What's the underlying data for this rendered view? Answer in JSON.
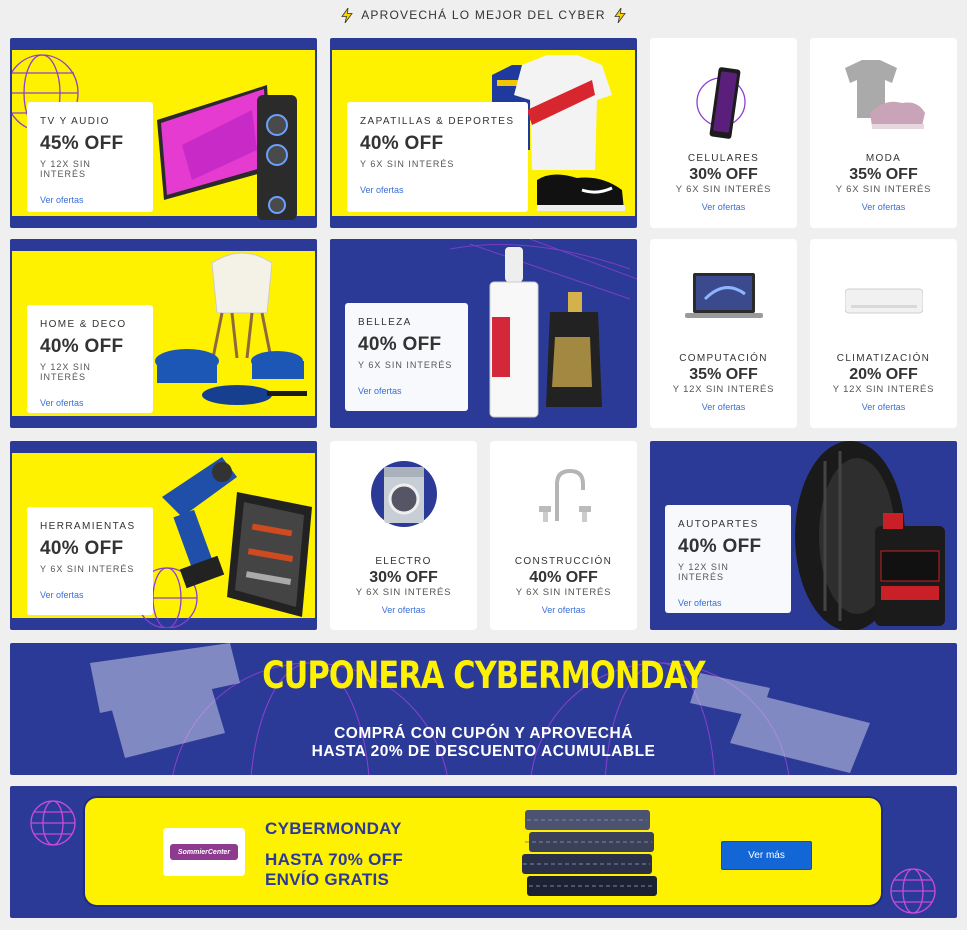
{
  "heading": {
    "text": "APROVECHÁ LO MEJOR DEL CYBER"
  },
  "colors": {
    "brand_blue": "#2c3a97",
    "brand_yellow": "#fff200",
    "link": "#3a6fd8",
    "button": "#1366d6"
  },
  "cards": [
    {
      "category": "TV Y AUDIO",
      "discount": "45% OFF",
      "installments": "Y 12X SIN INTERÉS",
      "link": "Ver ofertas"
    },
    {
      "category": "ZAPATILLAS & DEPORTES",
      "discount": "40% OFF",
      "installments": "Y 6X SIN INTERÉS",
      "link": "Ver ofertas"
    },
    {
      "category": "CELULARES",
      "discount": "30% OFF",
      "installments": "Y 6X SIN INTERÉS",
      "link": "Ver ofertas"
    },
    {
      "category": "MODA",
      "discount": "35% OFF",
      "installments": "Y 6X SIN INTERÉS",
      "link": "Ver ofertas"
    },
    {
      "category": "HOME & DECO",
      "discount": "40% OFF",
      "installments": "Y 12X SIN INTERÉS",
      "link": "Ver ofertas"
    },
    {
      "category": "BELLEZA",
      "discount": "40% OFF",
      "installments": "Y 6X SIN INTERÉS",
      "link": "Ver ofertas"
    },
    {
      "category": "COMPUTACIÓN",
      "discount": "35% OFF",
      "installments": "Y 12X SIN INTERÉS",
      "link": "Ver ofertas"
    },
    {
      "category": "CLIMATIZACIÓN",
      "discount": "20% OFF",
      "installments": "Y 12X SIN INTERÉS",
      "link": "Ver ofertas"
    },
    {
      "category": "HERRAMIENTAS",
      "discount": "40% OFF",
      "installments": "Y 6X SIN INTERÉS",
      "link": "Ver ofertas"
    },
    {
      "category": "ELECTRO",
      "discount": "30% OFF",
      "installments": "Y 6X SIN INTERÉS",
      "link": "Ver ofertas"
    },
    {
      "category": "CONSTRUCCIÓN",
      "discount": "40% OFF",
      "installments": "Y 6X SIN INTERÉS",
      "link": "Ver ofertas"
    },
    {
      "category": "AUTOPARTES",
      "discount": "40% OFF",
      "installments": "Y 12X SIN INTERÉS",
      "link": "Ver ofertas"
    }
  ],
  "cuponera": {
    "title": "CUPONERA CYBERMONDAY",
    "line1": "COMPRÁ CON CUPÓN Y APROVECHÁ",
    "line2": "HASTA 20% DE DESCUENTO ACUMULABLE"
  },
  "promo": {
    "brand_logo": "SommierCenter",
    "title": "CYBERMONDAY",
    "line1": "HASTA 70% OFF",
    "line2": "ENVÍO GRATIS",
    "button": "Ver más"
  }
}
